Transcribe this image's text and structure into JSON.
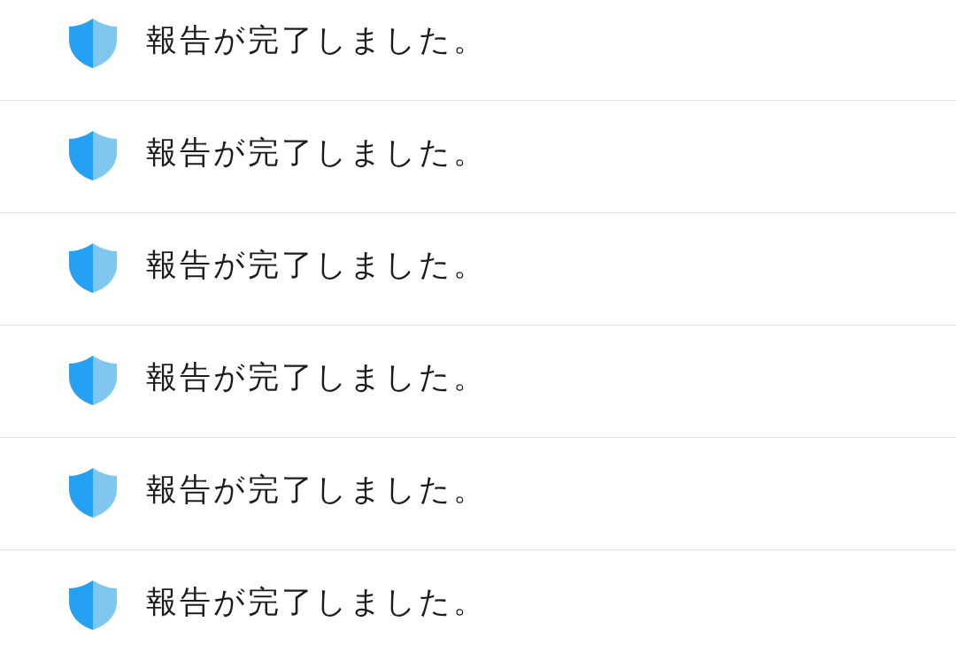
{
  "notifications": [
    {
      "message": "報告が完了しました。"
    },
    {
      "message": "報告が完了しました。"
    },
    {
      "message": "報告が完了しました。"
    },
    {
      "message": "報告が完了しました。"
    },
    {
      "message": "報告が完了しました。"
    },
    {
      "message": "報告が完了しました。"
    }
  ]
}
